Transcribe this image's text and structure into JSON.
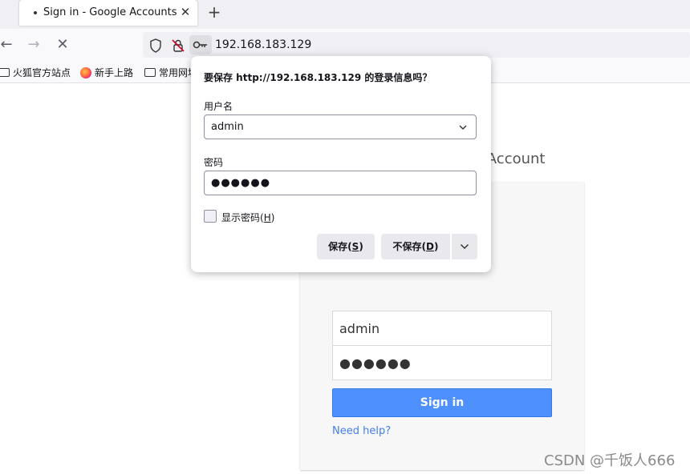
{
  "tab": {
    "title": "Sign in - Google Accounts",
    "close": "✕"
  },
  "newtab": "+",
  "nav": {
    "back": "←",
    "forward": "→",
    "stop": "✕",
    "url": "192.168.183.129"
  },
  "bookmarks": [
    {
      "label": "火狐官方站点",
      "icon": "folder-icon"
    },
    {
      "label": "新手上路",
      "icon": "firefox-icon"
    },
    {
      "label": "常用网址",
      "icon": "folder-icon"
    }
  ],
  "page": {
    "heading_fragment": "e Account",
    "username_value": "admin",
    "password_value": "●●●●●●",
    "signin_label": "Sign in",
    "help_link": "Need help?"
  },
  "popup": {
    "title": "要保存 http://192.168.183.129 的登录信息吗？",
    "username_label": "用户名",
    "username_value": "admin",
    "password_label": "密码",
    "password_value": "●●●●●●",
    "show_password": "显示密码(",
    "show_password_key": "H",
    "show_password_end": ")",
    "save_label": "保存(",
    "save_key": "S",
    "save_end": ")",
    "dont_save_label": "不保存(",
    "dont_save_key": "D",
    "dont_save_end": ")",
    "more": "⌄"
  },
  "watermark": "CSDN @千饭人666"
}
